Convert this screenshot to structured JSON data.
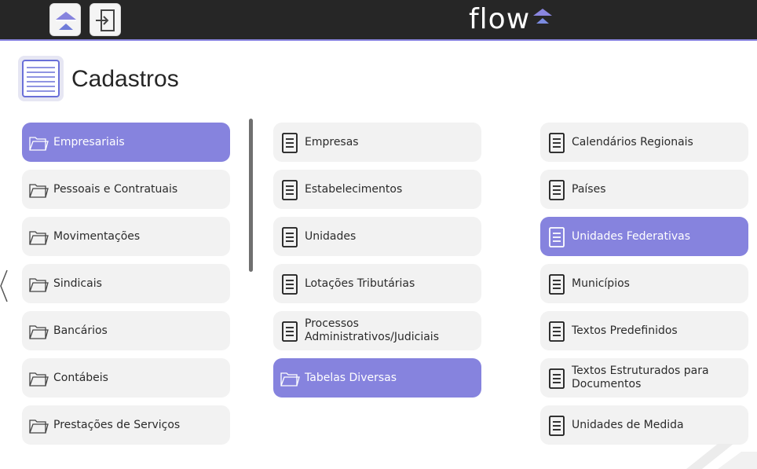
{
  "topbar": {
    "brand": "flow",
    "buttons": [
      {
        "name": "home-button",
        "icon": "flow-logo-icon"
      },
      {
        "name": "logout-button",
        "icon": "exit-icon"
      }
    ]
  },
  "header": {
    "title": "Cadastros",
    "icon": "list-document-icon"
  },
  "categories": [
    {
      "label": "Empresariais",
      "active": true
    },
    {
      "label": "Pessoais e Contratuais",
      "active": false
    },
    {
      "label": "Movimentações",
      "active": false
    },
    {
      "label": "Sindicais",
      "active": false
    },
    {
      "label": "Bancários",
      "active": false
    },
    {
      "label": "Contábeis",
      "active": false
    },
    {
      "label": "Prestações de Serviços",
      "active": false
    }
  ],
  "middle_items": [
    {
      "label": "Empresas",
      "icon": "document-icon",
      "active": false
    },
    {
      "label": "Estabelecimentos",
      "icon": "document-icon",
      "active": false
    },
    {
      "label": "Unidades",
      "icon": "document-icon",
      "active": false
    },
    {
      "label": "Lotações Tributárias",
      "icon": "document-icon",
      "active": false
    },
    {
      "label": "Processos Administrativos/Judiciais",
      "icon": "document-icon",
      "active": false
    },
    {
      "label": "Tabelas Diversas",
      "icon": "folder-icon",
      "active": true
    }
  ],
  "right_items": [
    {
      "label": "Calendários Regionais",
      "active": false
    },
    {
      "label": "Países",
      "active": false
    },
    {
      "label": "Unidades Federativas",
      "active": true
    },
    {
      "label": "Municípios",
      "active": false
    },
    {
      "label": "Textos Predefinidos",
      "active": false
    },
    {
      "label": "Textos Estruturados para Documentos",
      "active": false
    },
    {
      "label": "Unidades de Medida",
      "active": false
    }
  ],
  "colors": {
    "accent": "#8683de",
    "topbar": "#262626",
    "tile": "#f2f2f2"
  }
}
